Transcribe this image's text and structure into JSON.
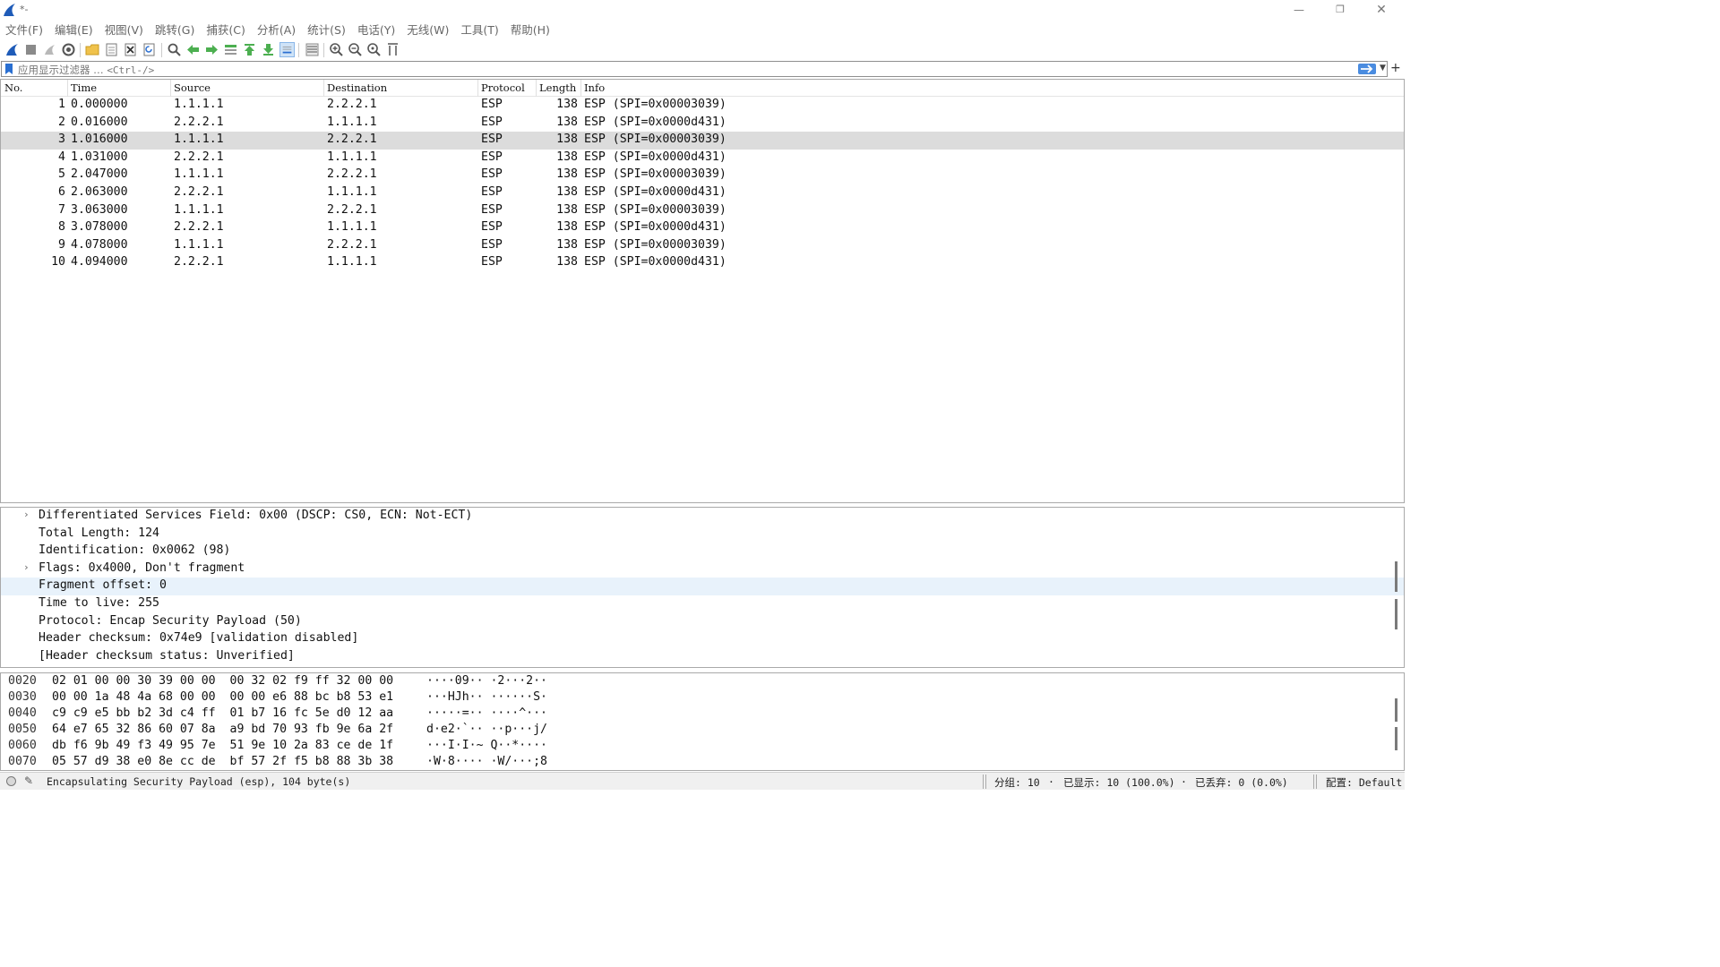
{
  "window": {
    "title": "*-"
  },
  "menu": [
    "文件(F)",
    "编辑(E)",
    "视图(V)",
    "跳转(G)",
    "捕获(C)",
    "分析(A)",
    "统计(S)",
    "电话(Y)",
    "无线(W)",
    "工具(T)",
    "帮助(H)"
  ],
  "toolbar": {
    "icons": [
      "start-capture-icon",
      "stop-capture-icon",
      "restart-capture-icon",
      "capture-options-icon",
      "open-file-icon",
      "save-file-icon",
      "close-file-icon",
      "reload-file-icon",
      "find-packet-icon",
      "go-back-icon",
      "go-forward-icon",
      "go-to-packet-icon",
      "go-first-packet-icon",
      "go-last-packet-icon",
      "auto-scroll-icon",
      "colorize-icon",
      "zoom-in-icon",
      "zoom-out-icon",
      "zoom-normal-icon",
      "resize-columns-icon"
    ]
  },
  "filter": {
    "placeholder": "应用显示过滤器 … ",
    "shortcut": "<Ctrl-/>"
  },
  "packet_list": {
    "columns": [
      "No.",
      "Time",
      "Source",
      "Destination",
      "Protocol",
      "Length",
      "Info"
    ],
    "selected_index": 2,
    "rows": [
      {
        "no": "1",
        "time": "0.000000",
        "source": "1.1.1.1",
        "destination": "2.2.2.1",
        "protocol": "ESP",
        "length": "138",
        "info": "ESP (SPI=0x00003039)"
      },
      {
        "no": "2",
        "time": "0.016000",
        "source": "2.2.2.1",
        "destination": "1.1.1.1",
        "protocol": "ESP",
        "length": "138",
        "info": "ESP (SPI=0x0000d431)"
      },
      {
        "no": "3",
        "time": "1.016000",
        "source": "1.1.1.1",
        "destination": "2.2.2.1",
        "protocol": "ESP",
        "length": "138",
        "info": "ESP (SPI=0x00003039)"
      },
      {
        "no": "4",
        "time": "1.031000",
        "source": "2.2.2.1",
        "destination": "1.1.1.1",
        "protocol": "ESP",
        "length": "138",
        "info": "ESP (SPI=0x0000d431)"
      },
      {
        "no": "5",
        "time": "2.047000",
        "source": "1.1.1.1",
        "destination": "2.2.2.1",
        "protocol": "ESP",
        "length": "138",
        "info": "ESP (SPI=0x00003039)"
      },
      {
        "no": "6",
        "time": "2.063000",
        "source": "2.2.2.1",
        "destination": "1.1.1.1",
        "protocol": "ESP",
        "length": "138",
        "info": "ESP (SPI=0x0000d431)"
      },
      {
        "no": "7",
        "time": "3.063000",
        "source": "1.1.1.1",
        "destination": "2.2.2.1",
        "protocol": "ESP",
        "length": "138",
        "info": "ESP (SPI=0x00003039)"
      },
      {
        "no": "8",
        "time": "3.078000",
        "source": "2.2.2.1",
        "destination": "1.1.1.1",
        "protocol": "ESP",
        "length": "138",
        "info": "ESP (SPI=0x0000d431)"
      },
      {
        "no": "9",
        "time": "4.078000",
        "source": "1.1.1.1",
        "destination": "2.2.2.1",
        "protocol": "ESP",
        "length": "138",
        "info": "ESP (SPI=0x00003039)"
      },
      {
        "no": "10",
        "time": "4.094000",
        "source": "2.2.2.1",
        "destination": "1.1.1.1",
        "protocol": "ESP",
        "length": "138",
        "info": "ESP (SPI=0x0000d431)"
      }
    ]
  },
  "details": {
    "highlighted_index": 4,
    "rows": [
      {
        "expandable": true,
        "text": "Differentiated Services Field: 0x00 (DSCP: CS0, ECN: Not-ECT)"
      },
      {
        "expandable": false,
        "text": "Total Length: 124"
      },
      {
        "expandable": false,
        "text": "Identification: 0x0062 (98)"
      },
      {
        "expandable": true,
        "text": "Flags: 0x4000, Don't fragment"
      },
      {
        "expandable": false,
        "text": "Fragment offset: 0"
      },
      {
        "expandable": false,
        "text": "Time to live: 255"
      },
      {
        "expandable": false,
        "text": "Protocol: Encap Security Payload (50)"
      },
      {
        "expandable": false,
        "text": "Header checksum: 0x74e9 [validation disabled]"
      },
      {
        "expandable": false,
        "text": "[Header checksum status: Unverified]"
      }
    ]
  },
  "bytes": {
    "rows": [
      {
        "offset": "0020",
        "hex_a": "02 01 00 00 30 39 00 00",
        "hex_b": "00 32 02 f9 ff 32 00 00",
        "ascii": "····09·· ·2···2··"
      },
      {
        "offset": "0030",
        "hex_a": "00 00 1a 48 4a 68 00 00",
        "hex_b": "00 00 e6 88 bc b8 53 e1",
        "ascii": "···HJh·· ······S·"
      },
      {
        "offset": "0040",
        "hex_a": "c9 c9 e5 bb b2 3d c4 ff",
        "hex_b": "01 b7 16 fc 5e d0 12 aa",
        "ascii": "·····=·· ····^···"
      },
      {
        "offset": "0050",
        "hex_a": "64 e7 65 32 86 60 07 8a",
        "hex_b": "a9 bd 70 93 fb 9e 6a 2f",
        "ascii": "d·e2·`·· ··p···j/"
      },
      {
        "offset": "0060",
        "hex_a": "db f6 9b 49 f3 49 95 7e",
        "hex_b": "51 9e 10 2a 83 ce de 1f",
        "ascii": "···I·I·~ Q··*····"
      },
      {
        "offset": "0070",
        "hex_a": "05 57 d9 38 e0 8e cc de",
        "hex_b": "bf 57 2f f5 b8 88 3b 38",
        "ascii": "·W·8···· ·W/···;8"
      }
    ]
  },
  "status": {
    "message": "Encapsulating Security Payload (esp), 104 byte(s)",
    "packets": "分组: 10",
    "displayed": "已显示: 10 (100.0%)",
    "dropped": "已丢弃: 0 (0.0%)",
    "profile": "配置: Default"
  },
  "colors": {
    "selected_row": "#dcdcdc",
    "highlight_row": "#e8f2fb",
    "fin_blue": "#1e5bb8"
  }
}
